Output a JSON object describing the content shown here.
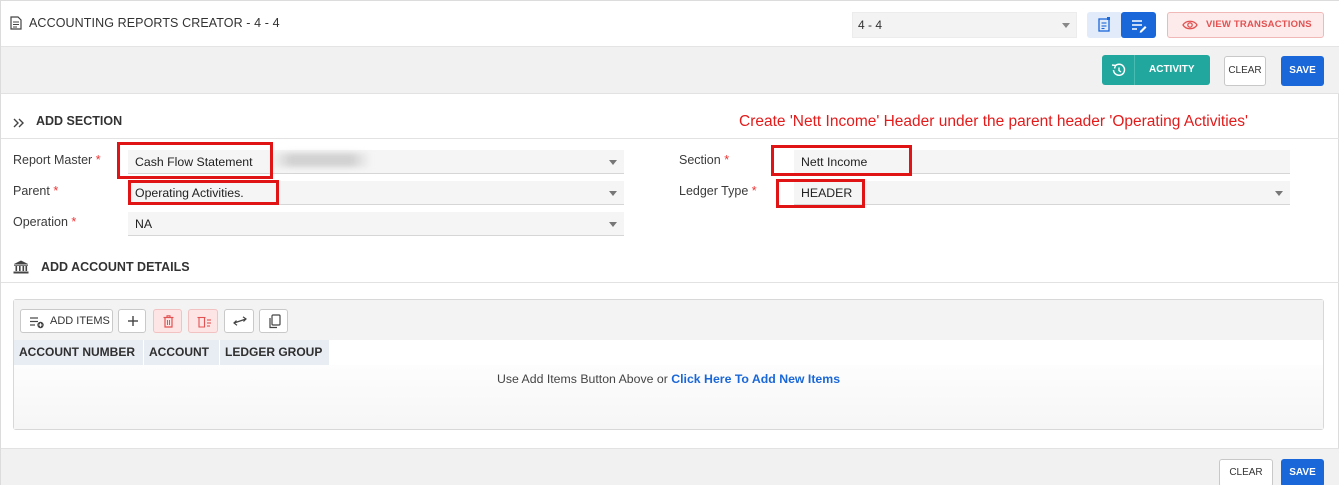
{
  "header": {
    "title": "ACCOUNTING REPORTS CREATOR - 4 - 4",
    "selector_value": "4 - 4",
    "view_transactions_label": "VIEW TRANSACTIONS"
  },
  "actions": {
    "activity_label": "ACTIVITY",
    "clear_label": "CLEAR",
    "save_label": "SAVE"
  },
  "add_section": {
    "title": "ADD SECTION",
    "annotation": "Create 'Nett Income' Header under the parent header 'Operating Activities'",
    "fields": {
      "report_master": {
        "label": "Report Master",
        "value": "Cash Flow Statement"
      },
      "parent": {
        "label": "Parent",
        "value": "Operating Activities."
      },
      "operation": {
        "label": "Operation",
        "value": "NA"
      },
      "section": {
        "label": "Section",
        "value": "Nett Income"
      },
      "ledger_type": {
        "label": "Ledger Type",
        "value": "HEADER"
      }
    },
    "required_mark": "*"
  },
  "account_details": {
    "title": "ADD ACCOUNT DETAILS",
    "add_items_label": "ADD ITEMS",
    "columns": [
      "ACCOUNT NUMBER",
      "ACCOUNT",
      "LEDGER GROUP"
    ],
    "empty_text": "Use Add Items Button Above or",
    "empty_link": "Click Here To Add New Items"
  },
  "footer": {
    "clear_label": "CLEAR",
    "save_label": "SAVE"
  },
  "colors": {
    "primary": "#1967d8",
    "activity": "#21a79d",
    "danger": "#e25252",
    "annotation": "#e21b1b"
  }
}
